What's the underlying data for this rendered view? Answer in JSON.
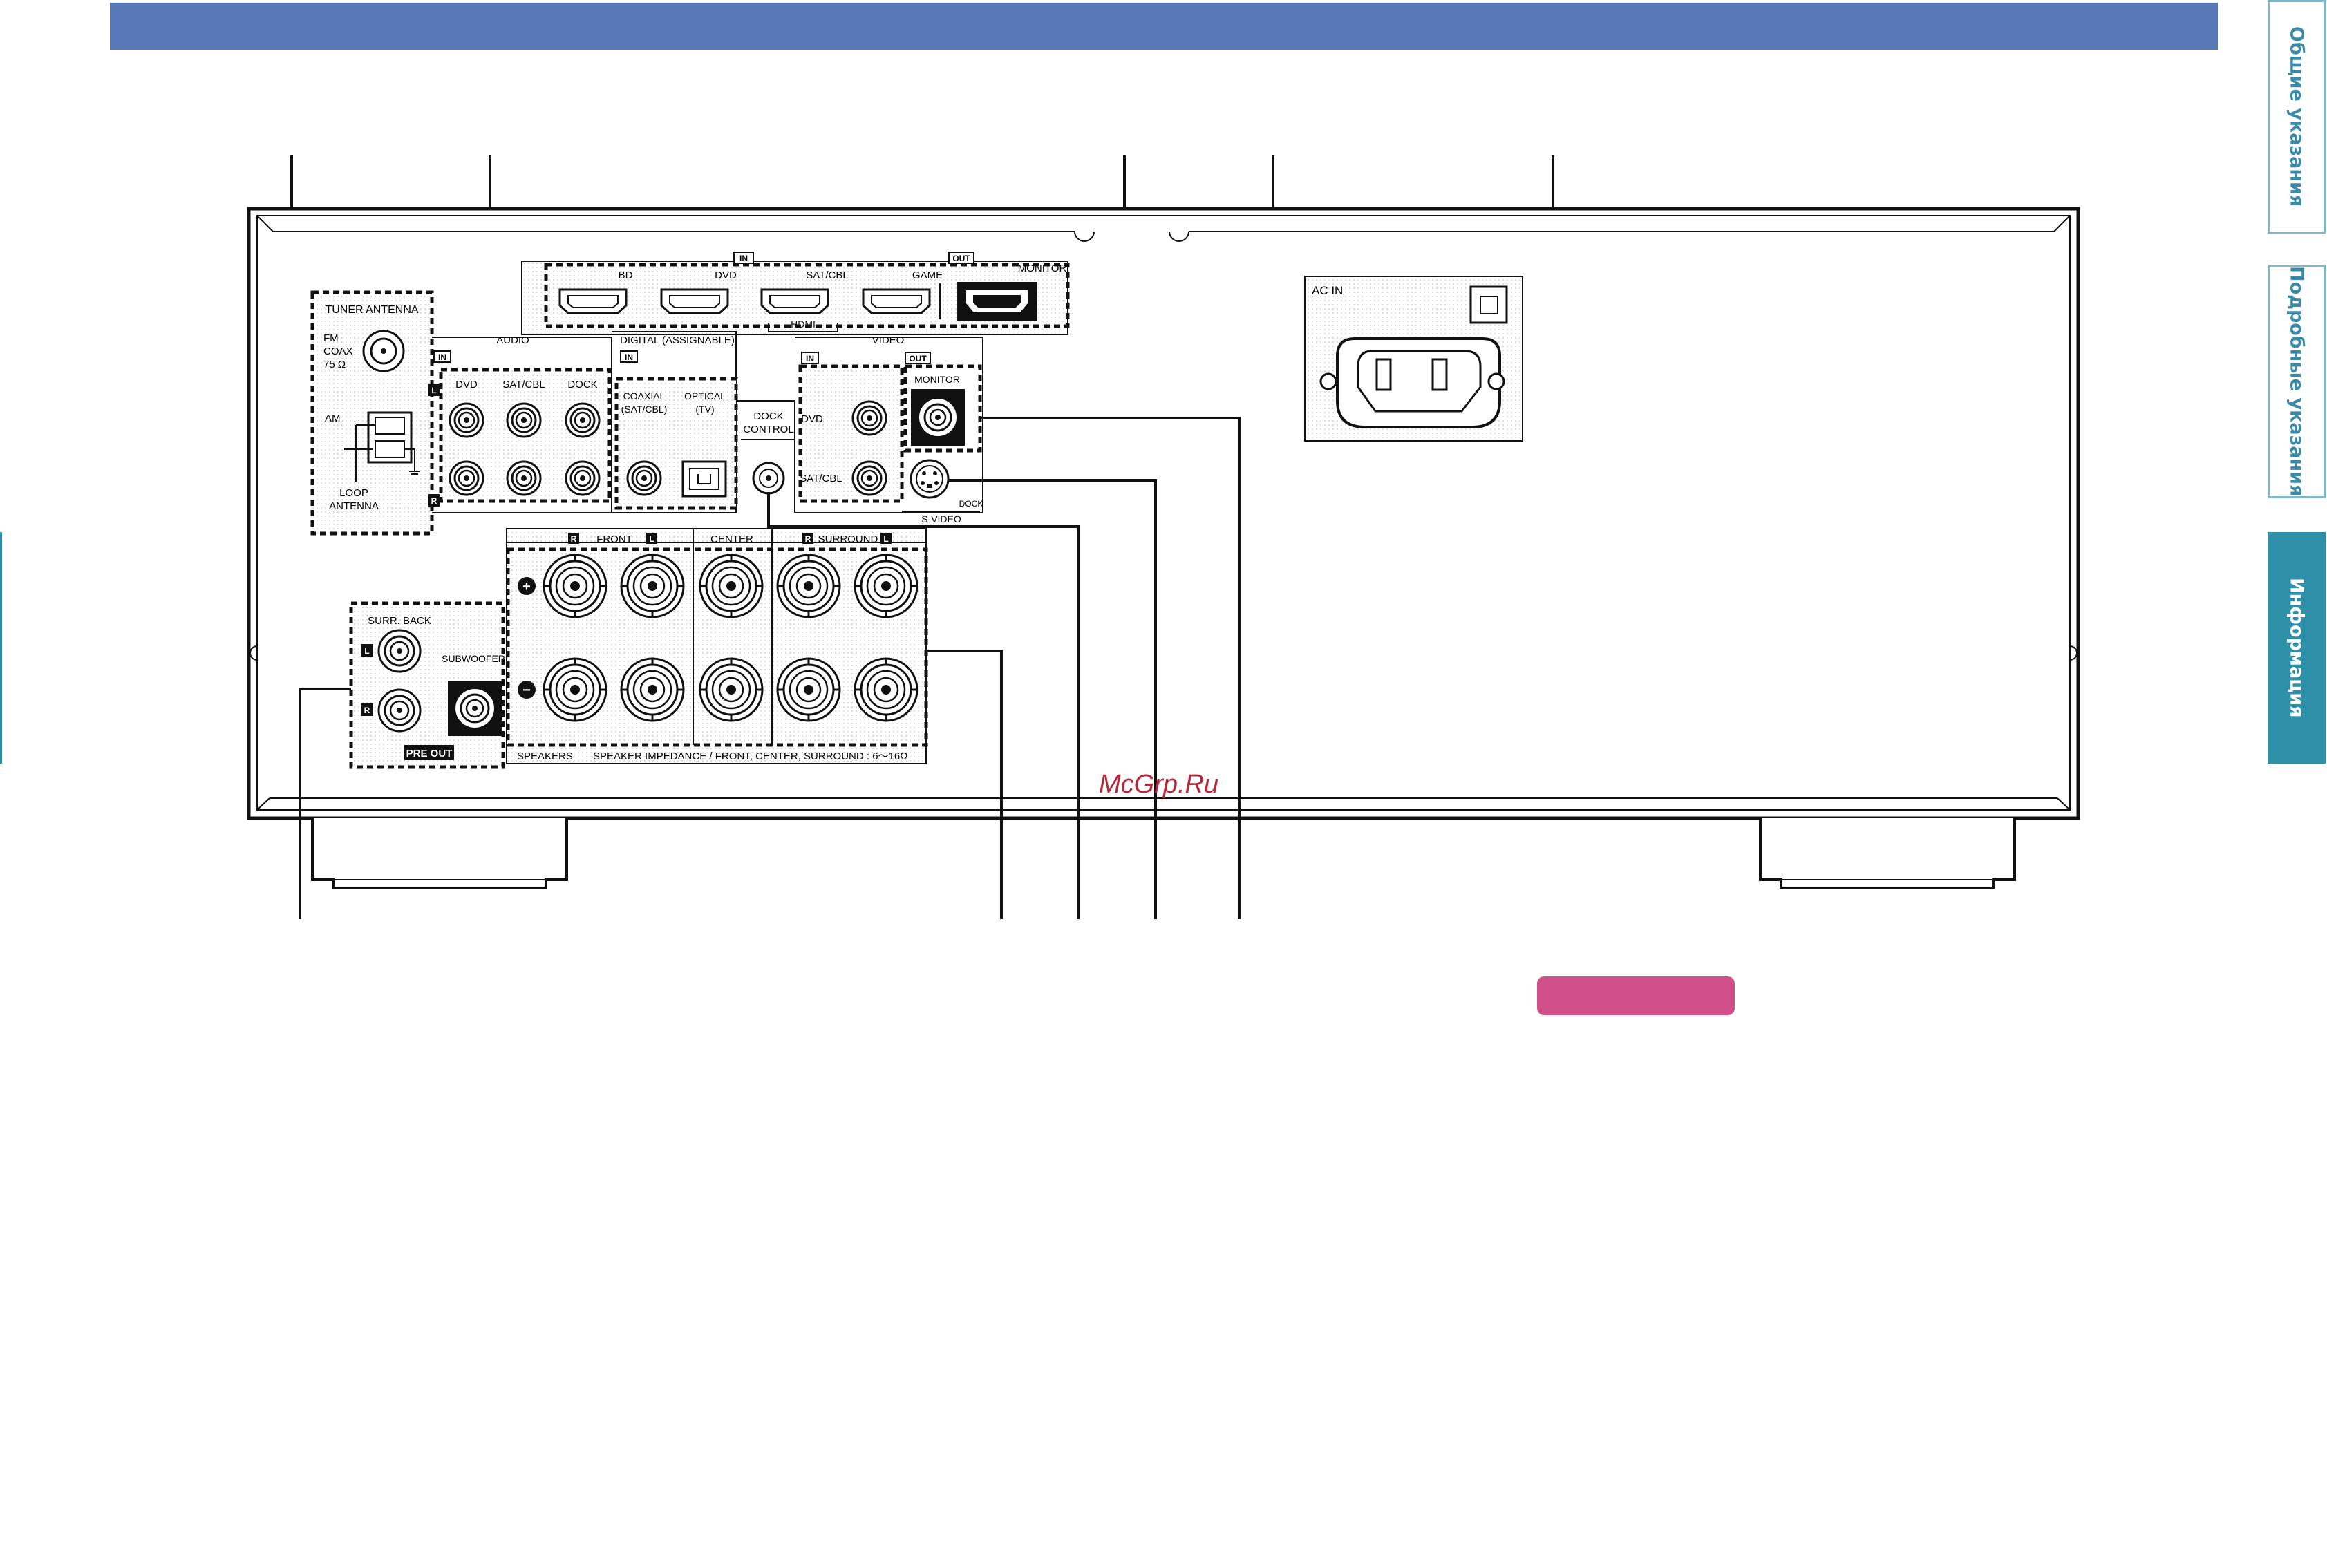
{
  "side_tabs": [
    {
      "label": "Общие указания"
    },
    {
      "label": "Подробные указания"
    },
    {
      "label": "Информация"
    }
  ],
  "watermark": "McGrp.Ru",
  "panel": {
    "hdmi": {
      "in_tag": "IN",
      "out_tag": "OUT",
      "inputs": [
        "BD",
        "DVD",
        "SAT/CBL",
        "GAME"
      ],
      "output": "MONITOR",
      "group": "HDMI"
    },
    "tuner": {
      "title": "TUNER ANTENNA",
      "fm_line1": "FM",
      "fm_line2": "COAX",
      "fm_line3": "75 Ω",
      "am": "AM",
      "loop_line1": "LOOP",
      "loop_line2": "ANTENNA"
    },
    "audio": {
      "title": "AUDIO",
      "in_tag": "IN",
      "l_tag": "L",
      "r_tag": "R",
      "inputs": [
        "DVD",
        "SAT/CBL",
        "DOCK"
      ]
    },
    "digital": {
      "title": "DIGITAL (ASSIGNABLE)",
      "in_tag": "IN",
      "coax_line1": "COAXIAL",
      "coax_line2": "(SAT/CBL)",
      "optical_line1": "OPTICAL",
      "optical_line2": "(TV)"
    },
    "dock": {
      "line1": "DOCK",
      "line2": "CONTROL"
    },
    "video": {
      "title": "VIDEO",
      "in_tag": "IN",
      "out_tag": "OUT",
      "monitor": "MONITOR",
      "inputs": [
        "DVD",
        "SAT/CBL"
      ],
      "dock": "DOCK",
      "svideo": "S-VIDEO"
    },
    "ac": {
      "label": "AC IN"
    },
    "speakers": {
      "front": "FRONT",
      "center": "CENTER",
      "surround": "SURROUND",
      "r_tag": "R",
      "l_tag": "L",
      "plus": "+",
      "minus": "−",
      "title": "SPEAKERS",
      "impedance": "SPEAKER IMPEDANCE / FRONT, CENTER, SURROUND : 6～16Ω"
    },
    "preout": {
      "surr_back": "SURR. BACK",
      "subwoofer": "SUBWOOFER",
      "l_tag": "L",
      "r_tag": "R",
      "title": "PRE OUT"
    }
  }
}
